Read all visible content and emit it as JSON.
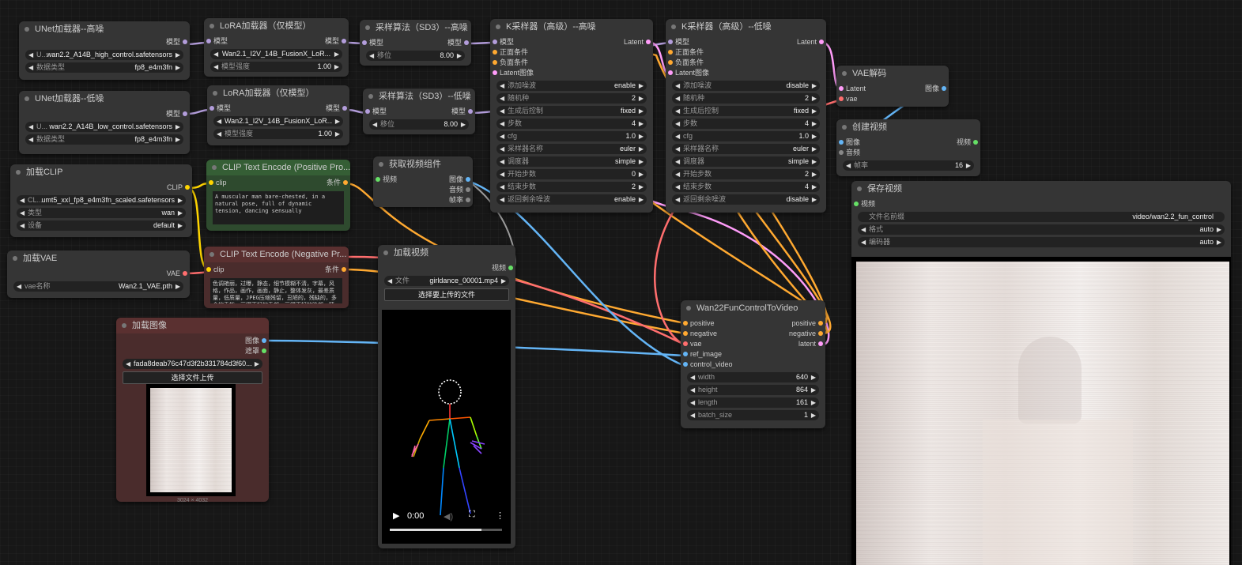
{
  "nodes": {
    "unet_high": {
      "title": "UNet加载器--高噪",
      "out_model": "模型",
      "file_prefix": "U...",
      "file": "wan2.2_A14B_high_control.safetensors",
      "dtype_label": "数据类型",
      "dtype": "fp8_e4m3fn"
    },
    "unet_low": {
      "title": "UNet加载器--低噪",
      "out_model": "模型",
      "file_prefix": "U...",
      "file": "wan2.2_A14B_low_control.safetensors",
      "dtype_label": "数据类型",
      "dtype": "fp8_e4m3fn"
    },
    "lora_high": {
      "title": "LoRA加载器（仅模型）",
      "in_model": "模型",
      "out_model": "模型",
      "file": "Wan2.1_I2V_14B_FusionX_LoR...",
      "strength_label": "模型强度",
      "strength": "1.00"
    },
    "lora_low": {
      "title": "LoRA加载器（仅模型）",
      "in_model": "模型",
      "out_model": "模型",
      "file": "Wan2.1_I2V_14B_FusionX_LoR...",
      "strength_label": "模型强度",
      "strength": "1.00"
    },
    "sd3_high": {
      "title": "采样算法（SD3）--高噪",
      "in_model": "模型",
      "out_model": "模型",
      "shift_label": "移位",
      "shift": "8.00"
    },
    "sd3_low": {
      "title": "采样算法（SD3）--低噪",
      "in_model": "模型",
      "out_model": "模型",
      "shift_label": "移位",
      "shift": "8.00"
    },
    "ksampler_high": {
      "title": "K采样器（高级）--高噪",
      "inputs": [
        "模型",
        "正面条件",
        "负面条件",
        "Latent图像"
      ],
      "output": "Latent",
      "widgets": [
        {
          "label": "添加噪波",
          "value": "enable"
        },
        {
          "label": "随机种",
          "value": "2"
        },
        {
          "label": "生成后控制",
          "value": "fixed"
        },
        {
          "label": "步数",
          "value": "4"
        },
        {
          "label": "cfg",
          "value": "1.0"
        },
        {
          "label": "采样器名称",
          "value": "euler"
        },
        {
          "label": "调度器",
          "value": "simple"
        },
        {
          "label": "开始步数",
          "value": "0"
        },
        {
          "label": "结束步数",
          "value": "2"
        },
        {
          "label": "返回剩余噪波",
          "value": "enable"
        }
      ]
    },
    "ksampler_low": {
      "title": "K采样器（高级）--低噪",
      "inputs": [
        "模型",
        "正面条件",
        "负面条件",
        "Latent图像"
      ],
      "output": "Latent",
      "widgets": [
        {
          "label": "添加噪波",
          "value": "disable"
        },
        {
          "label": "随机种",
          "value": "2"
        },
        {
          "label": "生成后控制",
          "value": "fixed"
        },
        {
          "label": "步数",
          "value": "4"
        },
        {
          "label": "cfg",
          "value": "1.0"
        },
        {
          "label": "采样器名称",
          "value": "euler"
        },
        {
          "label": "调度器",
          "value": "simple"
        },
        {
          "label": "开始步数",
          "value": "2"
        },
        {
          "label": "结束步数",
          "value": "4"
        },
        {
          "label": "返回剩余噪波",
          "value": "disable"
        }
      ]
    },
    "vae_decode": {
      "title": "VAE解码",
      "in_latent": "Latent",
      "in_vae": "vae",
      "out_image": "图像"
    },
    "create_video": {
      "title": "创建视频",
      "in_image": "图像",
      "in_audio": "音频",
      "out_video": "视频",
      "fps_label": "帧率",
      "fps": "16"
    },
    "save_video": {
      "title": "保存视频",
      "in_video": "视频",
      "prefix_label": "文件名前缀",
      "prefix": "video/wan2.2_fun_control",
      "format_label": "格式",
      "format": "auto",
      "codec_label": "编码器",
      "codec": "auto"
    },
    "load_clip": {
      "title": "加载CLIP",
      "out_clip": "CLIP",
      "file_prefix": "CL...",
      "file": "umt5_xxl_fp8_e4m3fn_scaled.safetensors",
      "type_label": "类型",
      "type": "wan",
      "device_label": "设备",
      "device": "default"
    },
    "clip_pos": {
      "title": "CLIP Text Encode (Positive Pro...",
      "in_clip": "clip",
      "out_cond": "条件",
      "text": "A muscular man bare-chested, in a natural pose, full of dynamic tension, dancing sensually"
    },
    "clip_neg": {
      "title": "CLIP Text Encode (Negative Pr...",
      "in_clip": "clip",
      "out_cond": "条件",
      "text": "色调艳丽，过曝，静态，细节模糊不清，字幕，风格，作品，画作，画面，静止，整体发灰，最差质量，低质量，JPEG压缩残留，丑陋的，残缺的，多余的手指，画得不好的手部，画得不好的脸部，畸"
    },
    "get_video": {
      "title": "获取视频组件",
      "in_video": "视频",
      "out_image": "图像",
      "out_audio": "音频",
      "out_fps": "帧率"
    },
    "load_vae": {
      "title": "加载VAE",
      "out_vae": "VAE",
      "name_label": "vae名称",
      "name": "Wan2.1_VAE.pth"
    },
    "load_video": {
      "title": "加载视频",
      "out_video": "视频",
      "file_label": "文件",
      "file": "girldance_00001.mp4",
      "upload": "选择要上传的文件",
      "time": "0:00"
    },
    "load_image": {
      "title": "加载图像",
      "out_image": "图像",
      "out_mask": "遮罩",
      "file": "fada8deab76c47d3f2b331784d3f60...",
      "upload": "选择文件上传",
      "size": "3024 × 4032"
    },
    "wan22": {
      "title": "Wan22FunControlToVideo",
      "inputs": [
        "positive",
        "negative",
        "vae",
        "ref_image",
        "control_video"
      ],
      "outputs": [
        "positive",
        "negative",
        "latent"
      ],
      "widgets": [
        {
          "label": "width",
          "value": "640"
        },
        {
          "label": "height",
          "value": "864"
        },
        {
          "label": "length",
          "value": "161"
        },
        {
          "label": "batch_size",
          "value": "1"
        }
      ]
    }
  },
  "colors": {
    "model": "#b39ddb",
    "latent": "#ff9cf9",
    "conditioning": "#ffa931",
    "vae": "#ff6e6e",
    "image": "#64b5f6",
    "clip": "#ffd500",
    "video": "#66e066"
  }
}
